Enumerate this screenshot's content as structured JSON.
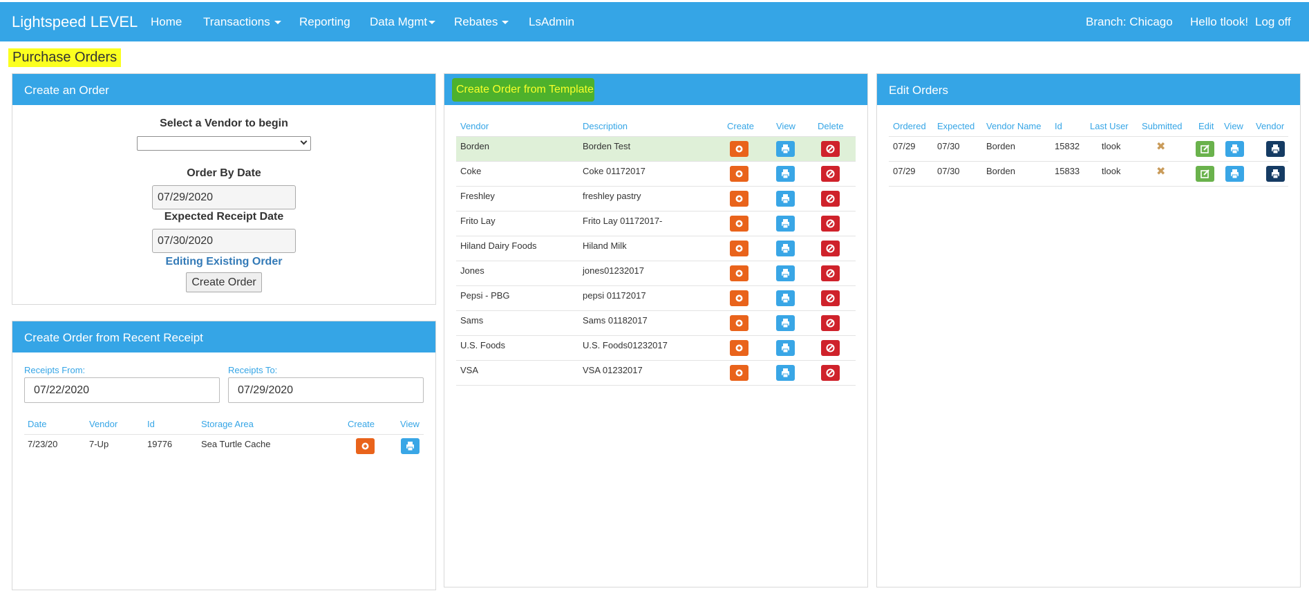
{
  "navbar": {
    "brand": "Lightspeed LEVEL",
    "items": [
      "Home",
      "Transactions",
      "Reporting",
      "Data Mgmt",
      "Rebates",
      "LsAdmin"
    ],
    "branch": "Branch: Chicago",
    "greeting": "Hello tlook!",
    "logoff": "Log off"
  },
  "page": {
    "title": "Purchase Orders"
  },
  "create_order": {
    "heading": "Create an Order",
    "vendor_label": "Select a Vendor to begin",
    "vendor_value": "",
    "order_by_label": "Order By Date",
    "order_by_value": "07/29/2020",
    "expected_label": "Expected Receipt Date",
    "expected_value": "07/30/2020",
    "editing_link": "Editing Existing Order",
    "create_button": "Create Order"
  },
  "recent_receipt": {
    "heading": "Create Order from Recent Receipt",
    "from_label": "Receipts From:",
    "from_value": "07/22/2020",
    "to_label": "Receipts To:",
    "to_value": "07/29/2020",
    "columns": [
      "Date",
      "Vendor",
      "Id",
      "Storage Area",
      "Create",
      "View"
    ],
    "rows": [
      {
        "date": "7/23/20",
        "vendor": "7-Up",
        "id": "19776",
        "area": "Sea Turtle Cache"
      }
    ]
  },
  "template": {
    "heading": "Create Order from Template",
    "columns": [
      "Vendor",
      "Description",
      "Create",
      "View",
      "Delete"
    ],
    "rows": [
      {
        "vendor": "Borden",
        "description": "Borden Test"
      },
      {
        "vendor": "Coke",
        "description": "Coke 01172017"
      },
      {
        "vendor": "Freshley",
        "description": "freshley pastry"
      },
      {
        "vendor": "Frito Lay",
        "description": "Frito Lay 01172017-"
      },
      {
        "vendor": "Hiland Dairy Foods",
        "description": "Hiland Milk"
      },
      {
        "vendor": "Jones",
        "description": "jones01232017"
      },
      {
        "vendor": "Pepsi - PBG",
        "description": "pepsi 01172017"
      },
      {
        "vendor": "Sams",
        "description": "Sams 01182017"
      },
      {
        "vendor": "U.S. Foods",
        "description": "U.S. Foods01232017"
      },
      {
        "vendor": "VSA",
        "description": "VSA 01232017"
      }
    ]
  },
  "edit_orders": {
    "heading": "Edit Orders",
    "columns": [
      "Ordered",
      "Expected",
      "Vendor Name",
      "Id",
      "Last User",
      "Submitted",
      "Edit",
      "View",
      "Vendor"
    ],
    "rows": [
      {
        "ordered": "07/29",
        "expected": "07/30",
        "vendor": "Borden",
        "id": "15832",
        "user": "tlook",
        "submitted": "✖"
      },
      {
        "ordered": "07/29",
        "expected": "07/30",
        "vendor": "Borden",
        "id": "15833",
        "user": "tlook",
        "submitted": "✖"
      }
    ]
  },
  "colors": {
    "primary": "#35a5e6",
    "highlight_yellow": "#fbff1f",
    "highlight_green": "#4db12c",
    "row_highlight": "#dff0d8",
    "orange": "#e9631b",
    "red": "#cf222b",
    "navy": "#153b63"
  },
  "icons": {
    "create": "plus-circle-icon",
    "view": "print-icon",
    "delete": "ban-icon",
    "edit": "edit-icon",
    "submitted": "x-icon"
  }
}
